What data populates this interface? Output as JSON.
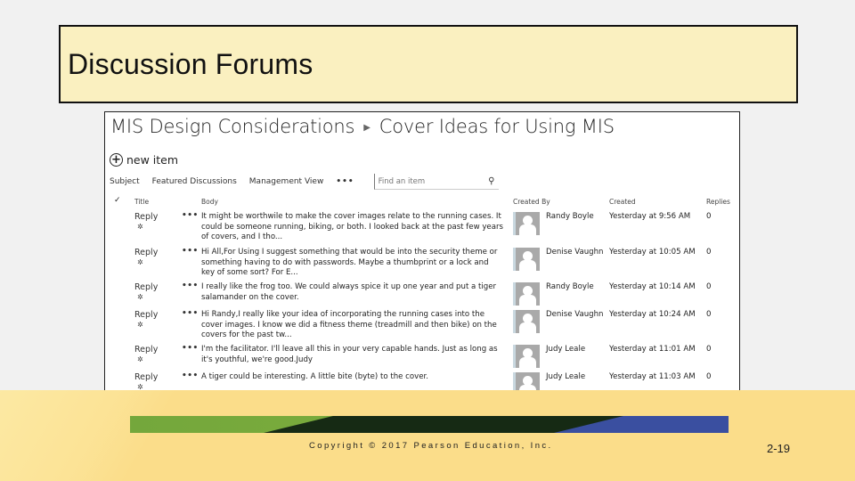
{
  "slide": {
    "title": "Discussion Forums",
    "copyright": "Copyright © 2017 Pearson Education, Inc.",
    "page_number": "2-19"
  },
  "screenshot": {
    "breadcrumb": {
      "parent": "MIS Design Considerations",
      "separator_icon": "triangle-right",
      "current": "Cover Ideas for Using MIS"
    },
    "new_item": {
      "icon": "plus-circle-icon",
      "label": "new item"
    },
    "views": [
      "Subject",
      "Featured Discussions",
      "Management View"
    ],
    "views_more": "•••",
    "search": {
      "placeholder": "Find an item",
      "icon": "search-icon"
    },
    "columns": {
      "check": "✓",
      "title": "Title",
      "body": "Body",
      "created_by": "Created By",
      "created": "Created",
      "replies": "Replies"
    },
    "rows": [
      {
        "title": "Reply",
        "actions": "•••",
        "body": "It might be worthwile to make the cover images relate to the running cases. It could be someone running, biking, or both. I looked back at the past few years of covers, and I tho...",
        "created_by": "Randy Boyle",
        "created": "Yesterday at 9:56 AM",
        "replies": "0"
      },
      {
        "title": "Reply",
        "actions": "•••",
        "body": "Hi All,For Using I suggest something that would be into the security theme or something having to do with passwords. Maybe a thumbprint or a lock and key of some sort? For E...",
        "created_by": "Denise Vaughn",
        "created": "Yesterday at 10:05 AM",
        "replies": "0"
      },
      {
        "title": "Reply",
        "actions": "•••",
        "body": "I really like the frog too. We could always spice it up one year and put a tiger salamander on the cover.",
        "created_by": "Randy Boyle",
        "created": "Yesterday at 10:14 AM",
        "replies": "0"
      },
      {
        "title": "Reply",
        "actions": "•••",
        "body": "Hi Randy,I really like your idea of incorporating the running cases into the cover images. I know we did a fitness theme (treadmill and then bike) on the covers for the past tw...",
        "created_by": "Denise Vaughn",
        "created": "Yesterday at 10:24 AM",
        "replies": "0"
      },
      {
        "title": "Reply",
        "actions": "•••",
        "body": "I'm the facilitator. I'll leave all this in your very capable hands. Just as long as it's youthful, we're good.Judy",
        "created_by": "Judy Leale",
        "created": "Yesterday at 11:01 AM",
        "replies": "0"
      },
      {
        "title": "Reply",
        "actions": "•••",
        "body": "A tiger could be interesting. A little bite (byte) to the cover.",
        "created_by": "Judy Leale",
        "created": "Yesterday at 11:03 AM",
        "replies": "0"
      }
    ]
  },
  "colors": {
    "title_box_bg": "#faf0c0",
    "footer_bg": "#fbdd8a",
    "band_green": "#7aab3d",
    "band_dark": "#162a14",
    "band_blue": "#3a4fa0"
  }
}
